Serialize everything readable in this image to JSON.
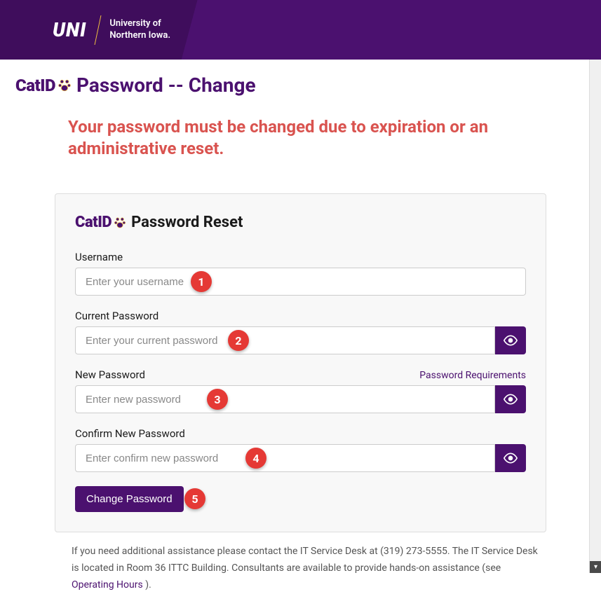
{
  "header": {
    "logo_text": "UNI",
    "org_name_line1": "University of",
    "org_name_line2": "Northern Iowa."
  },
  "page": {
    "catid_text": "CatID",
    "title": "Password -- Change",
    "alert_message": "Your password must be changed due to expiration or an administrative reset."
  },
  "card": {
    "catid_text": "CatID",
    "title": "Password Reset",
    "fields": {
      "username": {
        "label": "Username",
        "placeholder": "Enter your username"
      },
      "current_password": {
        "label": "Current Password",
        "placeholder": "Enter your current password"
      },
      "new_password": {
        "label": "New Password",
        "placeholder": "Enter new password",
        "requirements_link": "Password Requirements"
      },
      "confirm_password": {
        "label": "Confirm New Password",
        "placeholder": "Enter confirm new password"
      }
    },
    "submit_label": "Change Password"
  },
  "footer": {
    "text_part1": "If you need additional assistance please contact the IT Service Desk at (319) 273-5555. The IT Service Desk is located in Room 36 ITTC Building. Consultants are available to provide hands-on assistance (see ",
    "link_text": "Operating Hours",
    "text_part2": " )."
  },
  "annotations": {
    "a1": "1",
    "a2": "2",
    "a3": "3",
    "a4": "4",
    "a5": "5"
  }
}
